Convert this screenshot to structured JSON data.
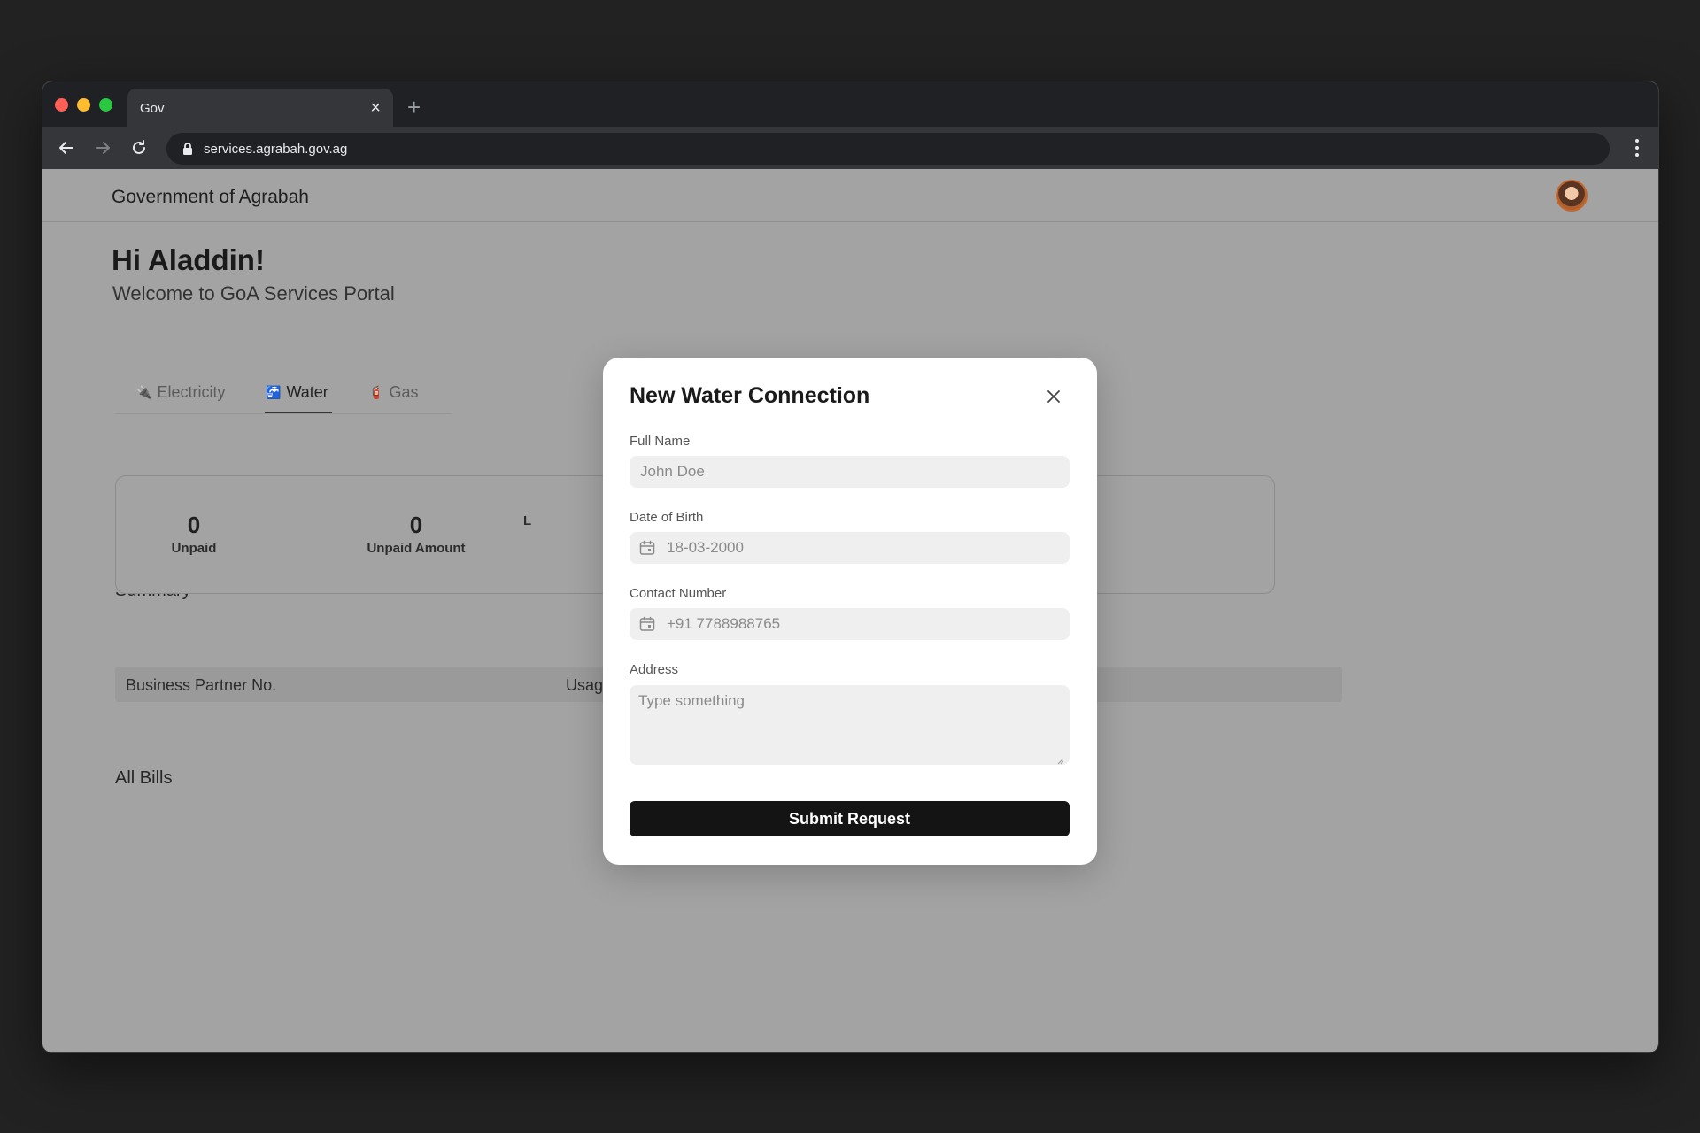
{
  "browser": {
    "tab_title": "Gov",
    "tab_close_icon": "×",
    "new_tab_icon": "+",
    "url": "services.agrabah.gov.ag"
  },
  "site": {
    "title": "Government of Agrabah"
  },
  "page": {
    "greeting": "Hi Aladdin!",
    "welcome": "Welcome to GoA Services Portal"
  },
  "service_tabs": [
    {
      "icon": "🔌",
      "label": "Electricity",
      "active": false
    },
    {
      "icon": "🚰",
      "label": "Water",
      "active": true
    },
    {
      "icon": "🧯",
      "label": "Gas",
      "active": false
    }
  ],
  "summary": {
    "title": "Summary",
    "stats": [
      {
        "value": "0",
        "label": "Unpaid"
      },
      {
        "value": "0",
        "label": "Unpaid Amount"
      },
      {
        "value": "",
        "label": "L"
      }
    ]
  },
  "bills": {
    "title": "All Bills",
    "columns": [
      "Business Partner No.",
      "Usag"
    ]
  },
  "modal": {
    "title": "New Water Connection",
    "full_name": {
      "label": "Full Name",
      "placeholder": "John Doe"
    },
    "dob": {
      "label": "Date of Birth",
      "placeholder": "18-03-2000"
    },
    "contact": {
      "label": "Contact Number",
      "placeholder": "+91 7788988765"
    },
    "address": {
      "label": "Address",
      "placeholder": "Type something"
    },
    "submit_label": "Submit Request"
  },
  "colors": {
    "overlay_background": "#a3a3a3",
    "primary_button": "#141414",
    "modal_background": "#ffffff"
  }
}
